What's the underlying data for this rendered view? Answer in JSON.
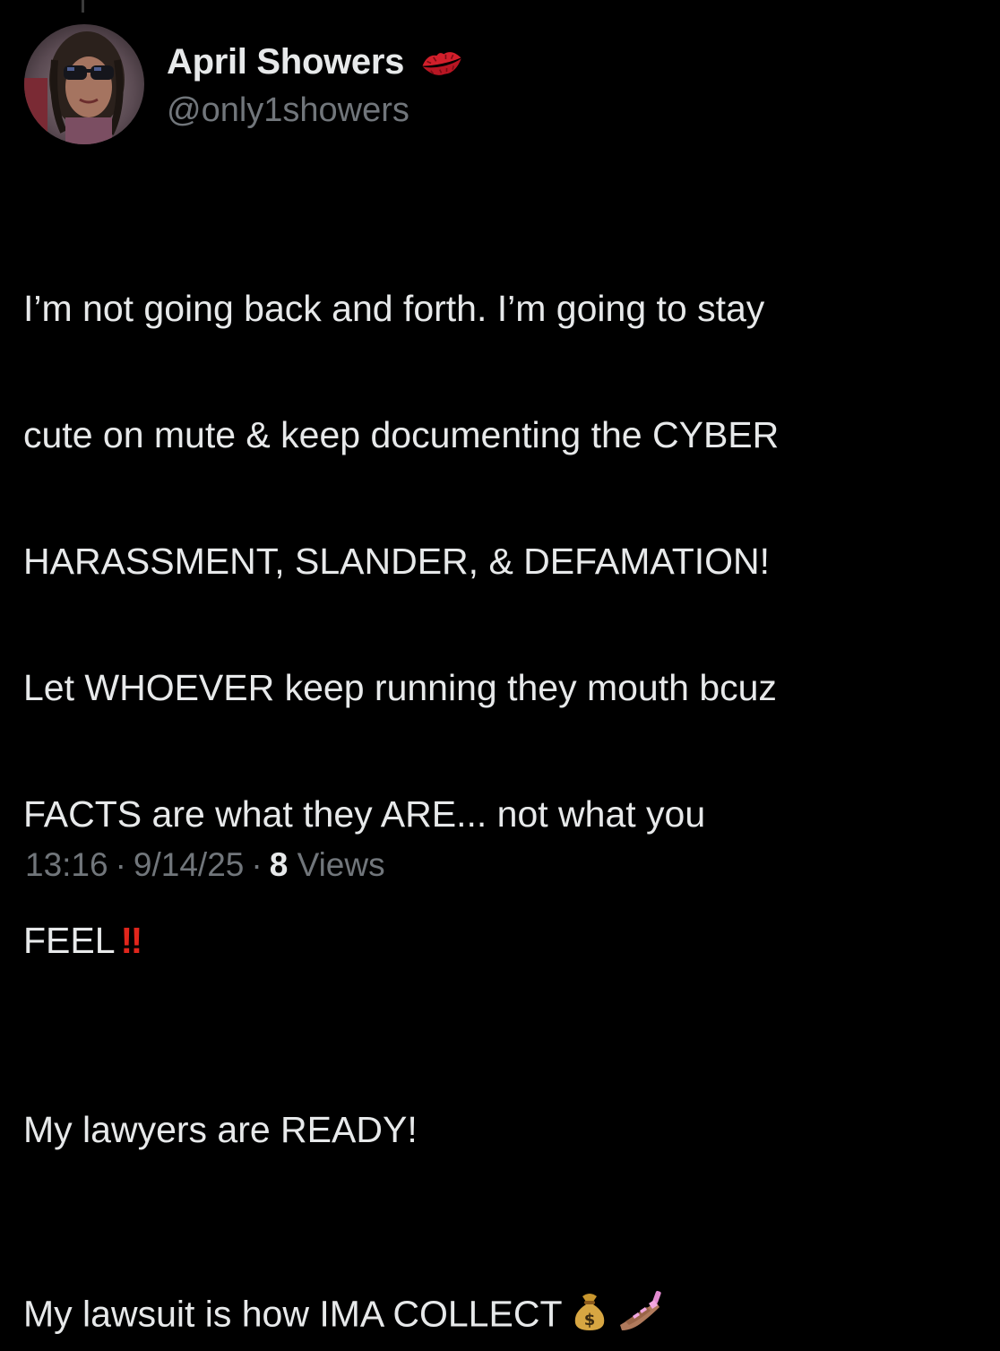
{
  "tweet": {
    "author": {
      "display_name": "April Showers",
      "name_emoji": "kiss-mark-icon",
      "handle": "@only1showers",
      "avatar": "profile-photo"
    },
    "paragraphs": [
      {
        "lines": [
          "I’m not going back and forth. I’m going to stay",
          "cute on mute & keep documenting the CYBER",
          "HARASSMENT, SLANDER, & DEFAMATION!",
          "Let WHOEVER keep running they mouth bcuz",
          "FACTS are what they ARE... not what you"
        ],
        "last_line": "FEEL",
        "trailing_emoji": "‼",
        "trailing_emoji_name": "double-exclamation-icon"
      },
      {
        "line1": "My lawyers are READY!",
        "line2": "My lawsuit is how IMA COLLECT",
        "trailing_emojis": [
          "money-bag-icon",
          "nail-polish-icon"
        ]
      }
    ],
    "meta": {
      "time": "13:16",
      "separator": "·",
      "date": "9/14/25",
      "views_count": "8",
      "views_label": "Views"
    }
  },
  "colors": {
    "background": "#000000",
    "primary_text": "#e7e9ea",
    "secondary_text": "#71767b",
    "exclamation_red": "#e1261c"
  }
}
